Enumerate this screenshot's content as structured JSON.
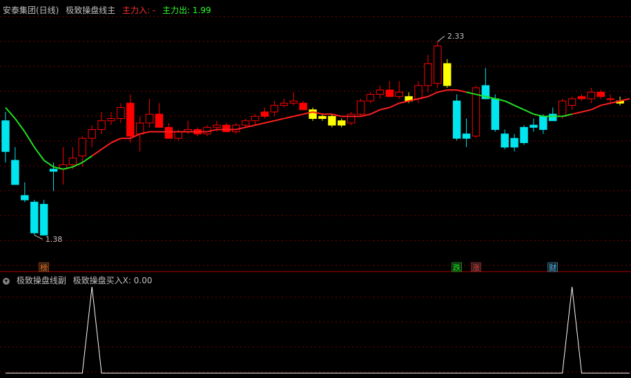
{
  "main_panel": {
    "stock_name": "安泰集团(日线)",
    "indicator_name": "极致操盘线主",
    "inflow_label": "主力入: -",
    "outflow_label": "主力出: 1.99",
    "inflow_color": "#ff3030",
    "outflow_color": "#30ff30"
  },
  "sub_panel": {
    "indicator_name": "极致操盘线副",
    "value_label": "极致操盘买入X: 0.00"
  },
  "colors": {
    "up": "#ff0000",
    "down": "#00e5ee",
    "neutral": "#ffff00",
    "ma_up": "#ff2020",
    "ma_down": "#22e022",
    "signal": "#ffffff"
  },
  "chart_data": [
    {
      "type": "candlestick",
      "ylim": [
        1.3,
        2.4
      ],
      "high_annotation": "2.33",
      "low_annotation": "1.38",
      "candles": [
        {
          "o": 1.92,
          "h": 1.96,
          "l": 1.73,
          "c": 1.78,
          "color": "down"
        },
        {
          "o": 1.74,
          "h": 1.8,
          "l": 1.63,
          "c": 1.63,
          "color": "down"
        },
        {
          "o": 1.58,
          "h": 1.64,
          "l": 1.55,
          "c": 1.56,
          "color": "down"
        },
        {
          "o": 1.55,
          "h": 1.56,
          "l": 1.4,
          "c": 1.41,
          "color": "down"
        },
        {
          "o": 1.54,
          "h": 1.56,
          "l": 1.4,
          "c": 1.4,
          "color": "down"
        },
        {
          "o": 1.7,
          "h": 1.73,
          "l": 1.6,
          "c": 1.69,
          "color": "down"
        },
        {
          "o": 1.7,
          "h": 1.8,
          "l": 1.63,
          "c": 1.72,
          "color": "up"
        },
        {
          "o": 1.72,
          "h": 1.8,
          "l": 1.7,
          "c": 1.75,
          "color": "up"
        },
        {
          "o": 1.76,
          "h": 1.85,
          "l": 1.71,
          "c": 1.84,
          "color": "up"
        },
        {
          "o": 1.84,
          "h": 1.9,
          "l": 1.8,
          "c": 1.88,
          "color": "up"
        },
        {
          "o": 1.88,
          "h": 1.96,
          "l": 1.86,
          "c": 1.92,
          "color": "up"
        },
        {
          "o": 1.92,
          "h": 1.96,
          "l": 1.9,
          "c": 1.93,
          "color": "up"
        },
        {
          "o": 1.93,
          "h": 2.0,
          "l": 1.91,
          "c": 1.98,
          "color": "up"
        },
        {
          "o": 2.0,
          "h": 2.04,
          "l": 1.82,
          "c": 1.85,
          "color": "red_fill"
        },
        {
          "o": 1.86,
          "h": 1.94,
          "l": 1.78,
          "c": 1.91,
          "color": "up"
        },
        {
          "o": 1.91,
          "h": 2.02,
          "l": 1.89,
          "c": 1.95,
          "color": "up"
        },
        {
          "o": 1.95,
          "h": 2.0,
          "l": 1.91,
          "c": 1.89,
          "color": "red_fill"
        },
        {
          "o": 1.89,
          "h": 1.91,
          "l": 1.84,
          "c": 1.84,
          "color": "red_fill"
        },
        {
          "o": 1.84,
          "h": 1.88,
          "l": 1.83,
          "c": 1.87,
          "color": "up"
        },
        {
          "o": 1.87,
          "h": 1.92,
          "l": 1.86,
          "c": 1.88,
          "color": "up"
        },
        {
          "o": 1.88,
          "h": 1.89,
          "l": 1.85,
          "c": 1.86,
          "color": "red_fill"
        },
        {
          "o": 1.86,
          "h": 1.9,
          "l": 1.85,
          "c": 1.89,
          "color": "up"
        },
        {
          "o": 1.89,
          "h": 1.92,
          "l": 1.87,
          "c": 1.9,
          "color": "up"
        },
        {
          "o": 1.9,
          "h": 1.91,
          "l": 1.87,
          "c": 1.87,
          "color": "red_fill"
        },
        {
          "o": 1.87,
          "h": 1.91,
          "l": 1.86,
          "c": 1.9,
          "color": "up"
        },
        {
          "o": 1.9,
          "h": 1.93,
          "l": 1.89,
          "c": 1.92,
          "color": "up"
        },
        {
          "o": 1.92,
          "h": 1.95,
          "l": 1.9,
          "c": 1.94,
          "color": "up"
        },
        {
          "o": 1.94,
          "h": 1.98,
          "l": 1.93,
          "c": 1.96,
          "color": "red_fill"
        },
        {
          "o": 1.96,
          "h": 2.01,
          "l": 1.94,
          "c": 1.99,
          "color": "up"
        },
        {
          "o": 1.99,
          "h": 2.02,
          "l": 1.98,
          "c": 2.0,
          "color": "up"
        },
        {
          "o": 2.0,
          "h": 2.05,
          "l": 1.99,
          "c": 2.01,
          "color": "up"
        },
        {
          "o": 2.0,
          "h": 2.01,
          "l": 1.97,
          "c": 1.97,
          "color": "red_fill"
        },
        {
          "o": 1.97,
          "h": 1.98,
          "l": 1.92,
          "c": 1.93,
          "color": "neutral"
        },
        {
          "o": 1.93,
          "h": 1.95,
          "l": 1.92,
          "c": 1.94,
          "color": "neutral"
        },
        {
          "o": 1.94,
          "h": 1.95,
          "l": 1.89,
          "c": 1.9,
          "color": "neutral"
        },
        {
          "o": 1.9,
          "h": 1.93,
          "l": 1.89,
          "c": 1.92,
          "color": "neutral"
        },
        {
          "o": 1.91,
          "h": 1.96,
          "l": 1.9,
          "c": 1.95,
          "color": "up"
        },
        {
          "o": 1.95,
          "h": 2.02,
          "l": 1.94,
          "c": 2.01,
          "color": "up"
        },
        {
          "o": 2.01,
          "h": 2.05,
          "l": 2.0,
          "c": 2.04,
          "color": "up"
        },
        {
          "o": 2.04,
          "h": 2.08,
          "l": 2.02,
          "c": 2.06,
          "color": "up"
        },
        {
          "o": 2.06,
          "h": 2.1,
          "l": 2.03,
          "c": 2.03,
          "color": "red_fill"
        },
        {
          "o": 2.03,
          "h": 2.1,
          "l": 2.02,
          "c": 2.05,
          "color": "up"
        },
        {
          "o": 2.03,
          "h": 2.05,
          "l": 2.0,
          "c": 2.01,
          "color": "neutral"
        },
        {
          "o": 2.02,
          "h": 2.1,
          "l": 2.0,
          "c": 2.08,
          "color": "up"
        },
        {
          "o": 2.08,
          "h": 2.22,
          "l": 2.05,
          "c": 2.18,
          "color": "up"
        },
        {
          "o": 2.09,
          "h": 2.28,
          "l": 2.07,
          "c": 2.26,
          "color": "up"
        },
        {
          "o": 2.18,
          "h": 2.2,
          "l": 2.07,
          "c": 2.08,
          "color": "neutral"
        },
        {
          "o": 2.01,
          "h": 2.04,
          "l": 1.83,
          "c": 1.84,
          "color": "down"
        },
        {
          "o": 1.84,
          "h": 1.93,
          "l": 1.8,
          "c": 1.86,
          "color": "down"
        },
        {
          "o": 1.85,
          "h": 2.08,
          "l": 1.84,
          "c": 2.07,
          "color": "up"
        },
        {
          "o": 2.08,
          "h": 2.16,
          "l": 2.02,
          "c": 2.02,
          "color": "down"
        },
        {
          "o": 2.02,
          "h": 2.04,
          "l": 1.87,
          "c": 1.88,
          "color": "down"
        },
        {
          "o": 1.86,
          "h": 1.88,
          "l": 1.79,
          "c": 1.8,
          "color": "down"
        },
        {
          "o": 1.8,
          "h": 1.86,
          "l": 1.78,
          "c": 1.84,
          "color": "down"
        },
        {
          "o": 1.82,
          "h": 1.9,
          "l": 1.81,
          "c": 1.89,
          "color": "down"
        },
        {
          "o": 1.89,
          "h": 1.93,
          "l": 1.87,
          "c": 1.9,
          "color": "down"
        },
        {
          "o": 1.88,
          "h": 1.95,
          "l": 1.86,
          "c": 1.94,
          "color": "down"
        },
        {
          "o": 1.95,
          "h": 1.98,
          "l": 1.92,
          "c": 1.92,
          "color": "down"
        },
        {
          "o": 1.94,
          "h": 2.02,
          "l": 1.93,
          "c": 2.01,
          "color": "up"
        },
        {
          "o": 1.99,
          "h": 2.03,
          "l": 1.97,
          "c": 2.02,
          "color": "up"
        },
        {
          "o": 2.02,
          "h": 2.04,
          "l": 2.01,
          "c": 2.03,
          "color": "red_fill"
        },
        {
          "o": 2.02,
          "h": 2.07,
          "l": 2.0,
          "c": 2.05,
          "color": "up"
        },
        {
          "o": 2.05,
          "h": 2.06,
          "l": 2.02,
          "c": 2.03,
          "color": "red_fill"
        },
        {
          "o": 2.02,
          "h": 2.04,
          "l": 2.0,
          "c": 2.02,
          "color": "up"
        },
        {
          "o": 2.01,
          "h": 2.03,
          "l": 1.99,
          "c": 2.0,
          "color": "neutral"
        }
      ],
      "ma_line": [
        1.98,
        1.93,
        1.87,
        1.8,
        1.74,
        1.71,
        1.7,
        1.71,
        1.73,
        1.76,
        1.79,
        1.82,
        1.84,
        1.84,
        1.86,
        1.87,
        1.87,
        1.87,
        1.87,
        1.87,
        1.87,
        1.87,
        1.88,
        1.88,
        1.88,
        1.89,
        1.9,
        1.91,
        1.92,
        1.93,
        1.94,
        1.95,
        1.96,
        1.95,
        1.95,
        1.94,
        1.94,
        1.94,
        1.95,
        1.97,
        1.98,
        2.0,
        2.01,
        2.02,
        2.03,
        2.05,
        2.06,
        2.06,
        2.05,
        2.04,
        2.03,
        2.02,
        2.01,
        1.99,
        1.97,
        1.95,
        1.94,
        1.94,
        1.94,
        1.95,
        1.96,
        1.97,
        1.99,
        2.0,
        2.01,
        2.02
      ],
      "ma_colors": [
        "down",
        "down",
        "down",
        "down",
        "down",
        "down",
        "down",
        "down",
        "down",
        "up",
        "up",
        "up",
        "up",
        "up",
        "up",
        "up",
        "up",
        "up",
        "up",
        "up",
        "up",
        "up",
        "up",
        "up",
        "up",
        "up",
        "up",
        "up",
        "up",
        "up",
        "up",
        "up",
        "up",
        "up",
        "up",
        "up",
        "up",
        "up",
        "up",
        "up",
        "up",
        "up",
        "up",
        "up",
        "up",
        "up",
        "up",
        "up",
        "down",
        "down",
        "down",
        "down",
        "down",
        "down",
        "down",
        "down",
        "down",
        "down",
        "down",
        "up",
        "up",
        "up",
        "up",
        "up",
        "up",
        "up"
      ],
      "markers": [
        {
          "index": 4,
          "label": "榜",
          "color": "#ff6600"
        },
        {
          "index": 47,
          "label": "跌",
          "color": "#00ff00"
        },
        {
          "index": 49,
          "label": "涨",
          "color": "#ff3030"
        },
        {
          "index": 57,
          "label": "财",
          "color": "#40c0ff"
        }
      ]
    },
    {
      "type": "line",
      "series": [
        {
          "values": [
            0,
            0,
            0,
            0,
            0,
            0,
            0,
            0,
            0,
            1,
            0,
            0,
            0,
            0,
            0,
            0,
            0,
            0,
            0,
            0,
            0,
            0,
            0,
            0,
            0,
            0,
            0,
            0,
            0,
            0,
            0,
            0,
            0,
            0,
            0,
            0,
            0,
            0,
            0,
            0,
            0,
            0,
            0,
            0,
            0,
            0,
            0,
            0,
            0,
            0,
            0,
            0,
            0,
            0,
            0,
            0,
            0,
            0,
            0,
            1,
            0,
            0,
            0,
            0,
            0,
            0
          ]
        }
      ],
      "ylim": [
        0,
        1
      ]
    }
  ]
}
